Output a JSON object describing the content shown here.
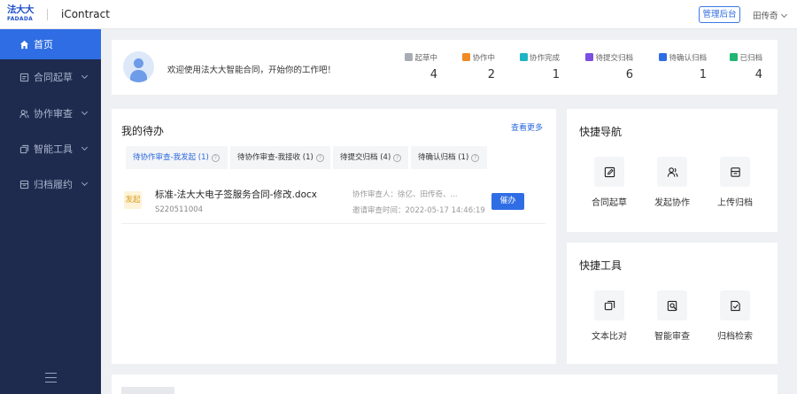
{
  "header": {
    "logo_cn": "法大大",
    "logo_en": "FADADA",
    "app_name": "iContract",
    "admin_button": "管理后台",
    "user_name": "田传奇"
  },
  "sidebar": {
    "items": [
      {
        "label": "首页",
        "icon": "home-icon",
        "active": true
      },
      {
        "label": "合同起草",
        "icon": "document-icon",
        "active": false
      },
      {
        "label": "协作审查",
        "icon": "users-icon",
        "active": false
      },
      {
        "label": "智能工具",
        "icon": "copy-icon",
        "active": false
      },
      {
        "label": "归档履约",
        "icon": "archive-icon",
        "active": false
      }
    ]
  },
  "welcome": {
    "text": "欢迎使用法大大智能合同，开始你的工作吧！",
    "stats": [
      {
        "label": "起草中",
        "value": "4",
        "color": "#a8adb5"
      },
      {
        "label": "协作中",
        "value": "2",
        "color": "#f08a24"
      },
      {
        "label": "协作完成",
        "value": "1",
        "color": "#1fb3c4"
      },
      {
        "label": "待提交归档",
        "value": "6",
        "color": "#7b4fe0"
      },
      {
        "label": "待确认归档",
        "value": "1",
        "color": "#2f6de4"
      },
      {
        "label": "已归档",
        "value": "4",
        "color": "#22b573"
      }
    ]
  },
  "todo": {
    "title": "我的待办",
    "see_more": "查看更多",
    "tabs": [
      {
        "label": "待协作审查-我发起",
        "count": "(1)"
      },
      {
        "label": "待协作审查-我接收",
        "count": "(1)"
      },
      {
        "label": "待提交归档",
        "count": "(4)"
      },
      {
        "label": "待确认归档",
        "count": "(1)"
      }
    ],
    "items": [
      {
        "badge": "发起",
        "name": "标准-法大大电子签服务合同-修改.docx",
        "id": "S220511004",
        "collaborators": "协作审查人：徐亿、田传奇、...",
        "time": "邀请审查时间：2022-05-17 14:46:19",
        "action": "催办"
      }
    ]
  },
  "quick_nav": {
    "title": "快捷导航",
    "items": [
      {
        "label": "合同起草",
        "icon": "edit-icon"
      },
      {
        "label": "发起协作",
        "icon": "users-icon"
      },
      {
        "label": "上传归档",
        "icon": "archive-box-icon"
      }
    ]
  },
  "quick_tools": {
    "title": "快捷工具",
    "items": [
      {
        "label": "文本比对",
        "icon": "compare-icon"
      },
      {
        "label": "智能审查",
        "icon": "search-doc-icon"
      },
      {
        "label": "归档检索",
        "icon": "file-search-icon"
      }
    ]
  }
}
